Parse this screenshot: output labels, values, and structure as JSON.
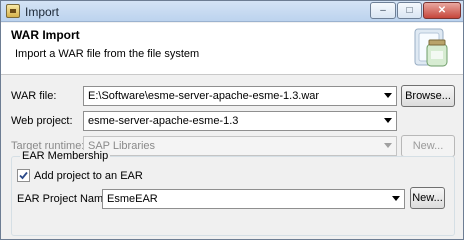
{
  "window": {
    "title": "Import",
    "min_glyph": "–",
    "max_glyph": "□",
    "close_glyph": "✕"
  },
  "header": {
    "title": "WAR Import",
    "description": "Import a WAR file from the file system",
    "icon": "jar-wizard-icon"
  },
  "war_file": {
    "label": "WAR file:",
    "value": "E:\\Software\\esme-server-apache-esme-1.3.war",
    "button": "Browse..."
  },
  "web_project": {
    "label": "Web project:",
    "value": "esme-server-apache-esme-1.3"
  },
  "target_runtime": {
    "label": "Target runtime:",
    "value": "SAP Libraries",
    "button": "New...",
    "enabled": false
  },
  "ear": {
    "group_title": "EAR Membership",
    "checkbox_label": "Add project to an EAR",
    "checked": true,
    "project_label": "EAR Project Name:",
    "project_value": "EsmeEAR",
    "button": "New..."
  }
}
